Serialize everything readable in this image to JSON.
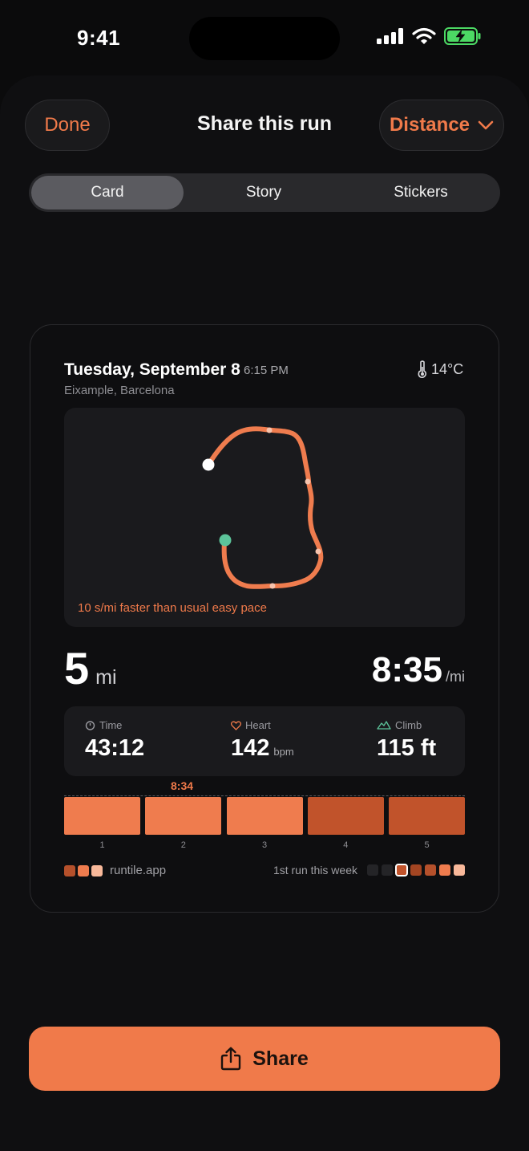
{
  "status_bar": {
    "time": "9:41"
  },
  "header": {
    "done_label": "Done",
    "title": "Share this run",
    "metric_label": "Distance"
  },
  "tabs": [
    {
      "label": "Card",
      "selected": true
    },
    {
      "label": "Story",
      "selected": false
    },
    {
      "label": "Stickers",
      "selected": false
    }
  ],
  "card": {
    "date": "Tuesday, September 8",
    "time": "6:15 PM",
    "location": "Eixample, Barcelona",
    "temperature": "14°C",
    "map_note": "10 s/mi faster than usual easy pace",
    "distance": {
      "value": "5",
      "unit": "mi"
    },
    "pace": {
      "value": "8:35",
      "unit": "/mi"
    },
    "stats": {
      "time": {
        "label": "Time",
        "value": "43:12"
      },
      "heart": {
        "label": "Heart",
        "value": "142",
        "unit": "bpm"
      },
      "climb": {
        "label": "Climb",
        "value": "115 ft"
      }
    },
    "splits": {
      "best_label": "8:34",
      "labels": [
        "1",
        "2",
        "3",
        "4",
        "5"
      ],
      "colors": [
        "#ef7c4e",
        "#ef7c4e",
        "#ef7c4e",
        "#c1532b",
        "#c1532b"
      ]
    },
    "brand": "runtile.app",
    "week_label": "1st run this week",
    "brand_colors": [
      "#b5502b",
      "#ef7c4e",
      "#f8b89a"
    ],
    "week_colors": [
      "#242427",
      "#242427",
      "#c1532b",
      "#a34522",
      "#b5502b",
      "#ef7c4e",
      "#f8b89a"
    ]
  },
  "share_label": "Share",
  "colors": {
    "accent": "#f07a4a",
    "start_dot": "#ffffff",
    "end_dot": "#5cc49a",
    "battery": "#4cd964"
  }
}
